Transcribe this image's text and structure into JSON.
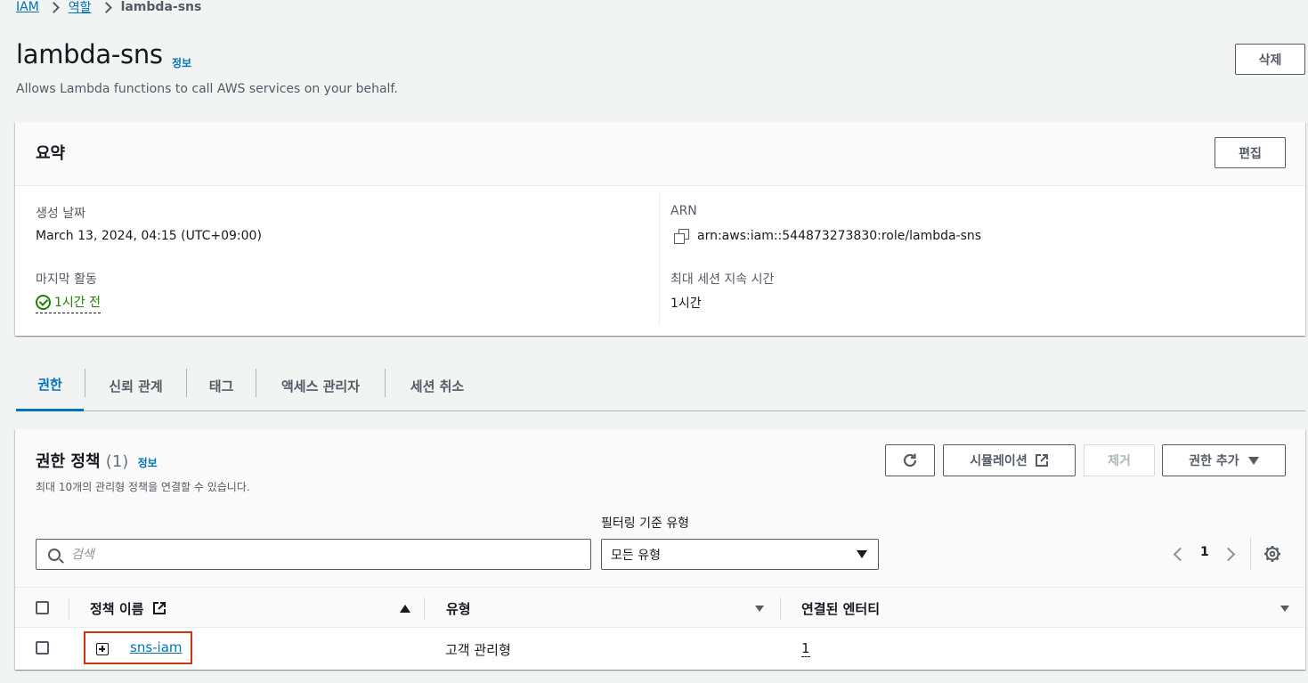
{
  "breadcrumb": {
    "items": [
      "IAM",
      "역할"
    ],
    "current": "lambda-sns"
  },
  "page": {
    "title": "lambda-sns",
    "info_label": "정보",
    "description": "Allows Lambda functions to call AWS services on your behalf.",
    "delete_label": "삭제"
  },
  "summary": {
    "title": "요약",
    "edit_label": "편집",
    "created_label": "생성 날짜",
    "created_value": "March 13, 2024, 04:15 (UTC+09:00)",
    "last_activity_label": "마지막 활동",
    "last_activity_value": "1시간 전",
    "arn_label": "ARN",
    "arn_value": "arn:aws:iam::544873273830:role/lambda-sns",
    "max_session_label": "최대 세션 지속 시간",
    "max_session_value": "1시간"
  },
  "tabs": [
    {
      "label": "권한",
      "active": true
    },
    {
      "label": "신뢰 관계"
    },
    {
      "label": "태그"
    },
    {
      "label": "액세스 관리자"
    },
    {
      "label": "세션 취소"
    }
  ],
  "policies": {
    "title": "권한 정책",
    "count": "(1)",
    "info_label": "정보",
    "description": "최대 10개의 관리형 정책을 연결할 수 있습니다.",
    "simulation_label": "시뮬레이션",
    "remove_label": "제거",
    "add_label": "권한 추가",
    "filter_label": "필터링 기준 유형",
    "search_placeholder": "검색",
    "filter_value": "모든 유형",
    "page_number": "1",
    "columns": {
      "name": "정책 이름",
      "type": "유형",
      "entities": "연결된 엔터티"
    },
    "rows": [
      {
        "name": "sns-iam",
        "type": "고객 관리형",
        "entities": "1"
      }
    ]
  },
  "icons": {
    "refresh": "refresh-icon",
    "external": "external-link-icon",
    "gear": "gear-icon",
    "copy": "copy-icon",
    "status": "check-circle-icon"
  },
  "colors": {
    "link": "#0073bb",
    "success": "#1d8102",
    "highlight": "#d13212"
  }
}
